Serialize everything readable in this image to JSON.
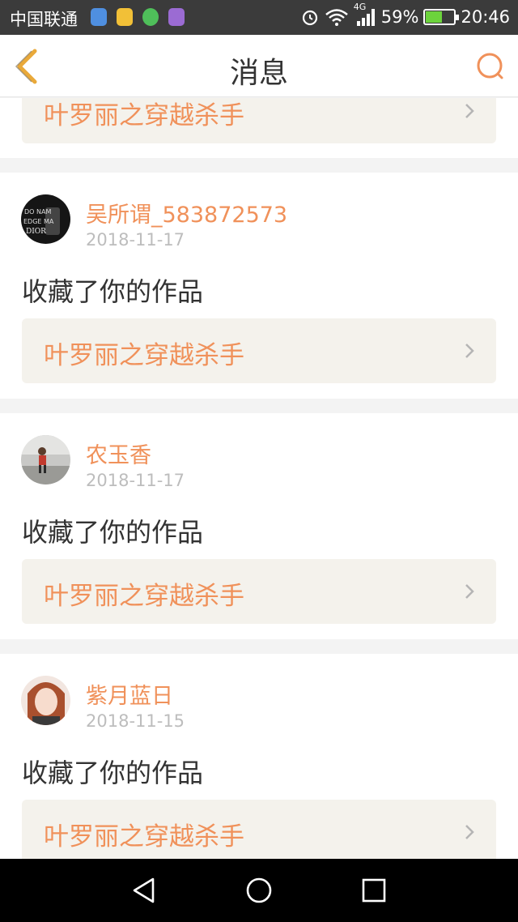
{
  "statusbar": {
    "carrier": "中国联通",
    "network": "4G",
    "battery_percent": "59%",
    "battery_level": 0.59,
    "time": "20:46",
    "app_icons": [
      "location-icon",
      "weibo-icon",
      "wechat-icon",
      "gallery-icon"
    ],
    "colors": {
      "background": "#3b3b3b",
      "battery_fill": "#6cd33c"
    }
  },
  "header": {
    "title": "消息",
    "back_icon": "chevron-left-icon",
    "search_icon": "search-icon"
  },
  "messages": [
    {
      "work_title": "叶罗丽之穿越杀手"
    },
    {
      "user": "吴所谓_583872573",
      "date": "2018-11-17",
      "action": "收藏了你的作品",
      "work_title": "叶罗丽之穿越杀手"
    },
    {
      "user": "农玉香",
      "date": "2018-11-17",
      "action": "收藏了你的作品",
      "work_title": "叶罗丽之穿越杀手"
    },
    {
      "user": "紫月蓝日",
      "date": "2018-11-15",
      "action": "收藏了你的作品",
      "work_title": "叶罗丽之穿越杀手"
    }
  ],
  "system_nav": [
    "back-triangle-icon",
    "home-circle-icon",
    "recents-square-icon"
  ],
  "colors": {
    "accent": "#f0915a",
    "link_bg": "#f4f2ec",
    "date": "#bdbdbd",
    "text": "#333333"
  }
}
